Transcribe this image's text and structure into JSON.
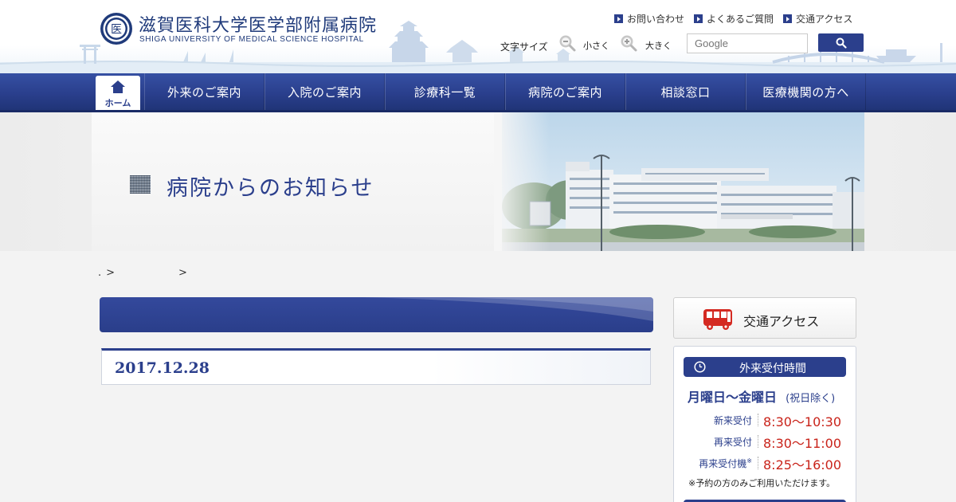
{
  "header": {
    "logo_kanji": "医",
    "title": "滋賀医科大学医学部附属病院",
    "subtitle": "SHIGA UNIVERSITY OF MEDICAL SCIENCE HOSPITAL",
    "util_links": [
      {
        "label": "お問い合わせ"
      },
      {
        "label": "よくあるご質問"
      },
      {
        "label": "交通アクセス"
      }
    ],
    "font_size_label": "文字サイズ",
    "font_small": "小さく",
    "font_large": "大きく",
    "search_placeholder": "Google"
  },
  "nav": {
    "home_label": "ホーム",
    "items": [
      {
        "label": "外来のご案内"
      },
      {
        "label": "入院のご案内"
      },
      {
        "label": "診療科一覧"
      },
      {
        "label": "病院のご案内"
      },
      {
        "label": "相談窓口"
      },
      {
        "label": "医療機関の方へ"
      }
    ]
  },
  "hero": {
    "title": "病院からのお知らせ"
  },
  "breadcrumb": {
    "items": [
      ".",
      ">",
      ">"
    ]
  },
  "article": {
    "heading": "",
    "date": "2017.12.28"
  },
  "sidebar": {
    "access_label": "交通アクセス",
    "hours": {
      "title": "外来受付時間",
      "days": "月曜日〜金曜日",
      "days_note": "(祝日除く)",
      "rows": [
        {
          "label": "新来受付",
          "time": "8:30〜10:30"
        },
        {
          "label": "再来受付",
          "time": "8:30〜11:00"
        },
        {
          "label": "再来受付機",
          "time": "8:25〜16:00",
          "mark": "※"
        }
      ],
      "note": "※予約の方のみご利用いただけます。"
    }
  },
  "colors": {
    "brand_navy": "#2b3f8c",
    "time_red": "#c9231a"
  }
}
